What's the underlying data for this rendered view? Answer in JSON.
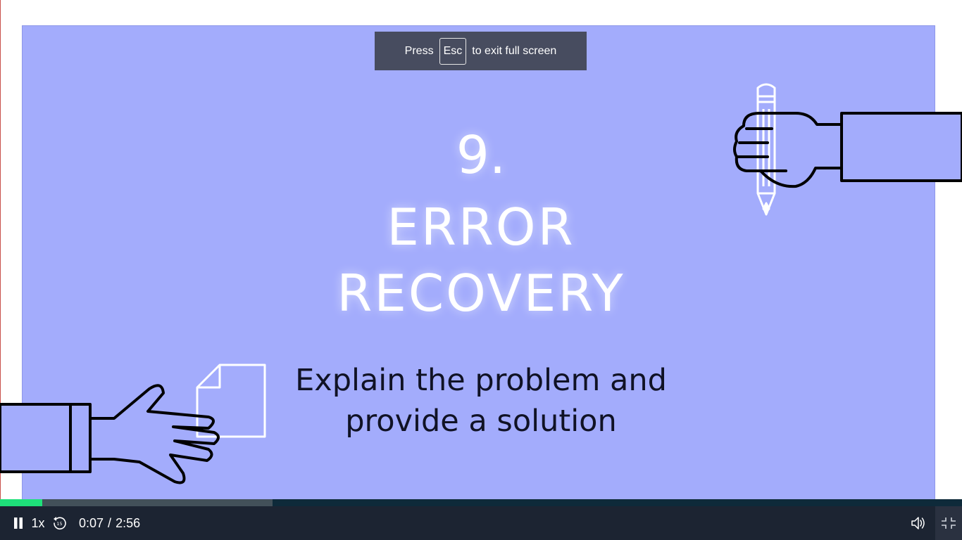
{
  "fullscreen_toast": {
    "press": "Press",
    "key": "Esc",
    "suffix": "to exit full screen"
  },
  "slide": {
    "number": "9.",
    "title_line1": "ERROR",
    "title_line2": "RECOVERY",
    "subtitle_line1": "Explain the problem and",
    "subtitle_line2": "provide a solution",
    "background": "#a3acfc"
  },
  "player": {
    "speed": "1x",
    "current_time": "0:07",
    "separator": "/",
    "duration": "2:56",
    "played_fraction": 0.044,
    "buffered_fraction": 0.283,
    "icons": [
      "pause-icon",
      "rewind-15-icon",
      "volume-icon",
      "exit-fullscreen-icon"
    ],
    "colors": {
      "played": "#1ee07a",
      "buffered": "#425059",
      "track": "#0e2a3a",
      "bar": "#1c2432"
    }
  }
}
